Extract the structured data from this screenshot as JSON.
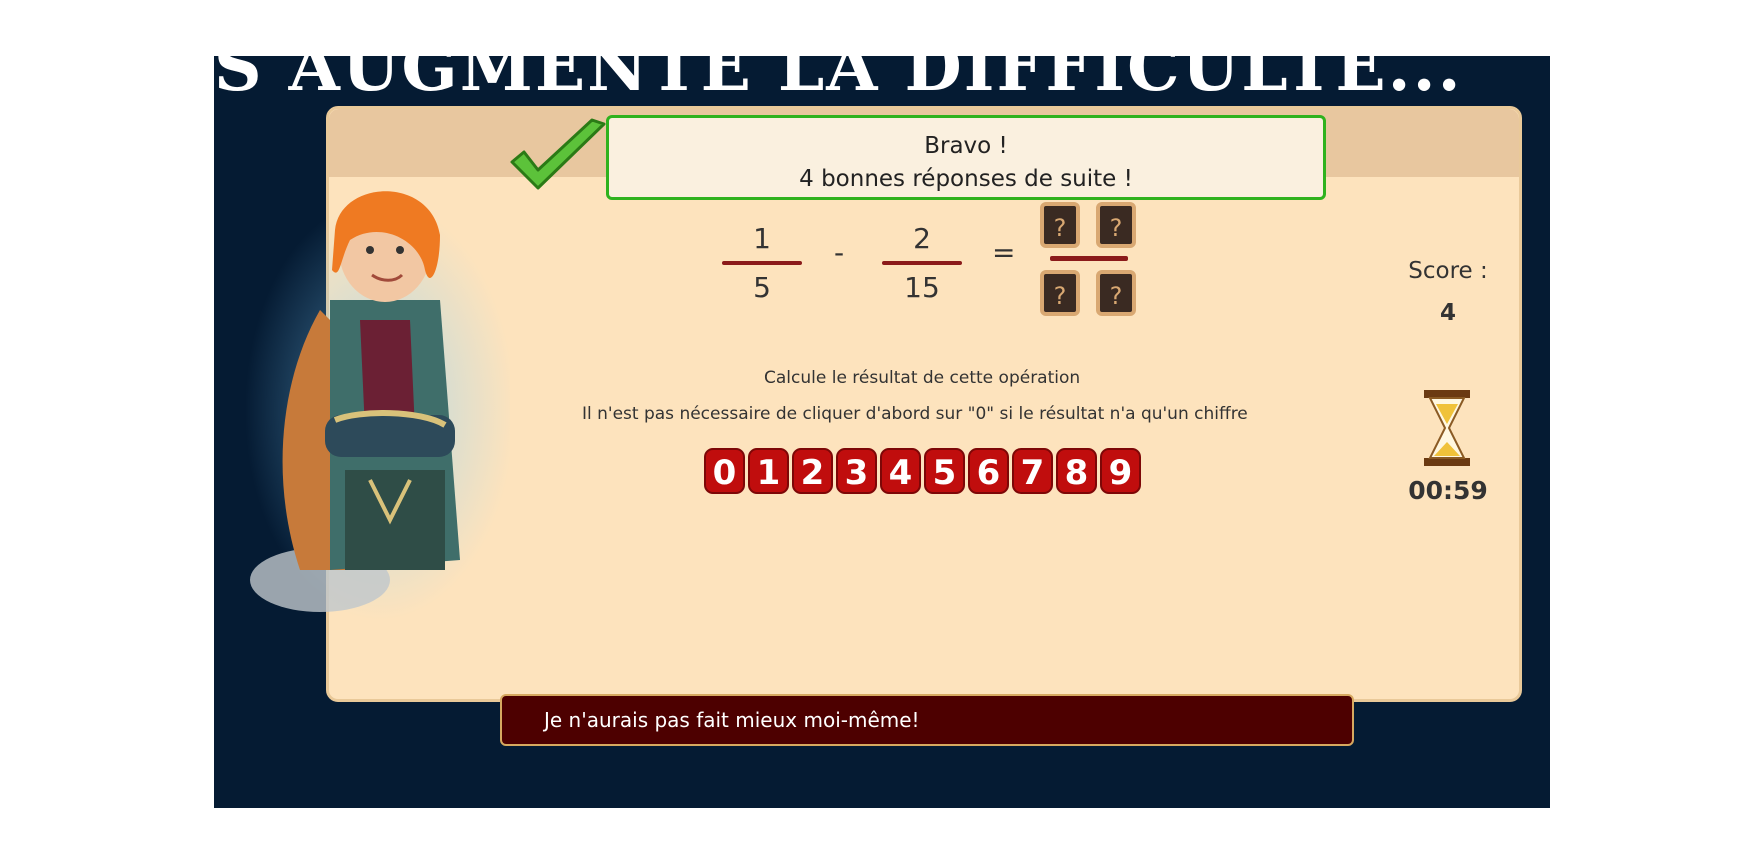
{
  "heading": "S AUGMENTE LA DIFFICULTÉ...",
  "feedback": {
    "line1": "Bravo !",
    "line2": "4 bonnes réponses de suite !"
  },
  "equation": {
    "fraction1": {
      "numerator": "1",
      "denominator": "5"
    },
    "operator": "-",
    "fraction2": {
      "numerator": "2",
      "denominator": "15"
    },
    "equals": "=",
    "unknown": [
      "?",
      "?",
      "?",
      "?"
    ]
  },
  "instructions": {
    "line1": "Calcule le résultat de cette opération",
    "line2": "Il n'est pas nécessaire de cliquer d'abord sur \"0\" si le résultat n'a qu'un chiffre"
  },
  "digits": [
    "0",
    "1",
    "2",
    "3",
    "4",
    "5",
    "6",
    "7",
    "8",
    "9"
  ],
  "score": {
    "label": "Score :",
    "value": "4"
  },
  "timer": "00:59",
  "message": "Je n'aurais pas fait mieux moi-même!",
  "colors": {
    "background": "#051b33",
    "panel": "#fde3bd",
    "digit_button": "#c00d0d",
    "success_border": "#2fb21e",
    "message_bar": "#4d0000"
  }
}
